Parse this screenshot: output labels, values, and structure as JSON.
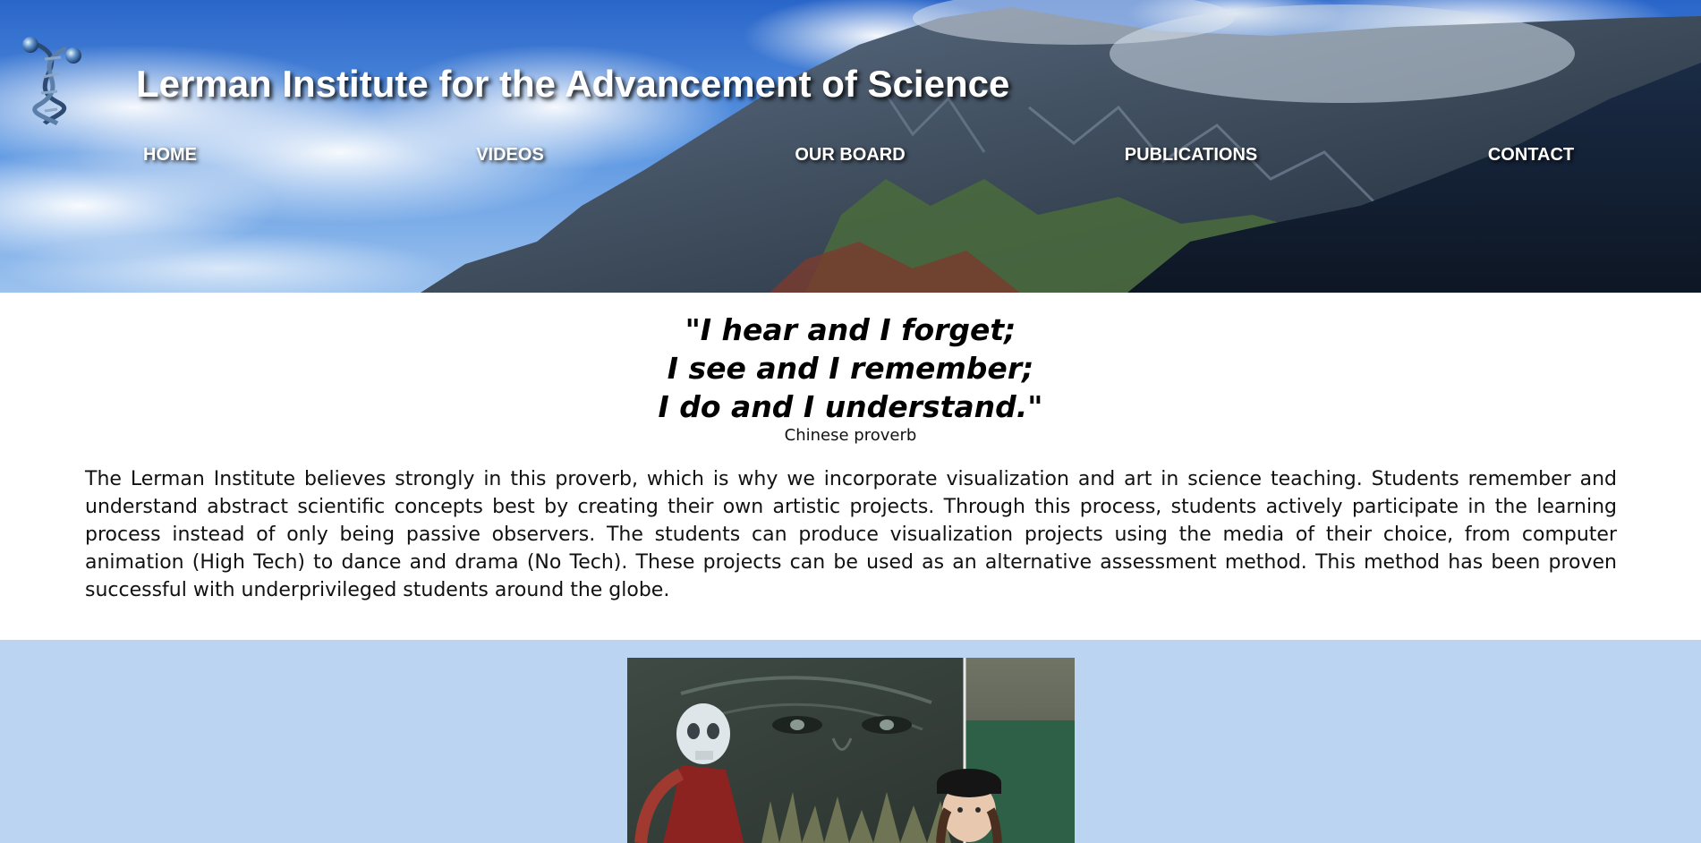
{
  "header": {
    "title": "Lerman Institute for the Advancement of Science",
    "logo_icon": "dna-helix-icon",
    "background": "mountain-and-clouds-photo"
  },
  "nav": {
    "items": [
      {
        "label": "HOME"
      },
      {
        "label": "VIDEOS"
      },
      {
        "label": "OUR BOARD"
      },
      {
        "label": "PUBLICATIONS"
      },
      {
        "label": "CONTACT"
      }
    ]
  },
  "quote": {
    "lines": [
      "\"I hear and I forget;",
      "I see and I remember;",
      "I do and I understand.\""
    ],
    "attribution": "Chinese proverb"
  },
  "intro": {
    "paragraph": "The Lerman Institute believes strongly in this proverb, which is why we incorporate visualization and art in science teaching. Students remember and understand abstract scientific concepts best by creating their own artistic projects. Through this process, students actively participate in the learning process instead of only being passive observers. The students can produce visualization projects using the media of their choice, from computer animation (High Tech) to dance and drama (No Tech). These projects can be used as an alternative assessment method. This method has been proven successful with underprivileged students around the globe."
  },
  "gallery": {
    "photo": "student-with-skeleton-mural-photo"
  },
  "colors": {
    "header_text": "#ffffff",
    "gallery_background": "#bad4f2",
    "body_text": "#111111"
  }
}
